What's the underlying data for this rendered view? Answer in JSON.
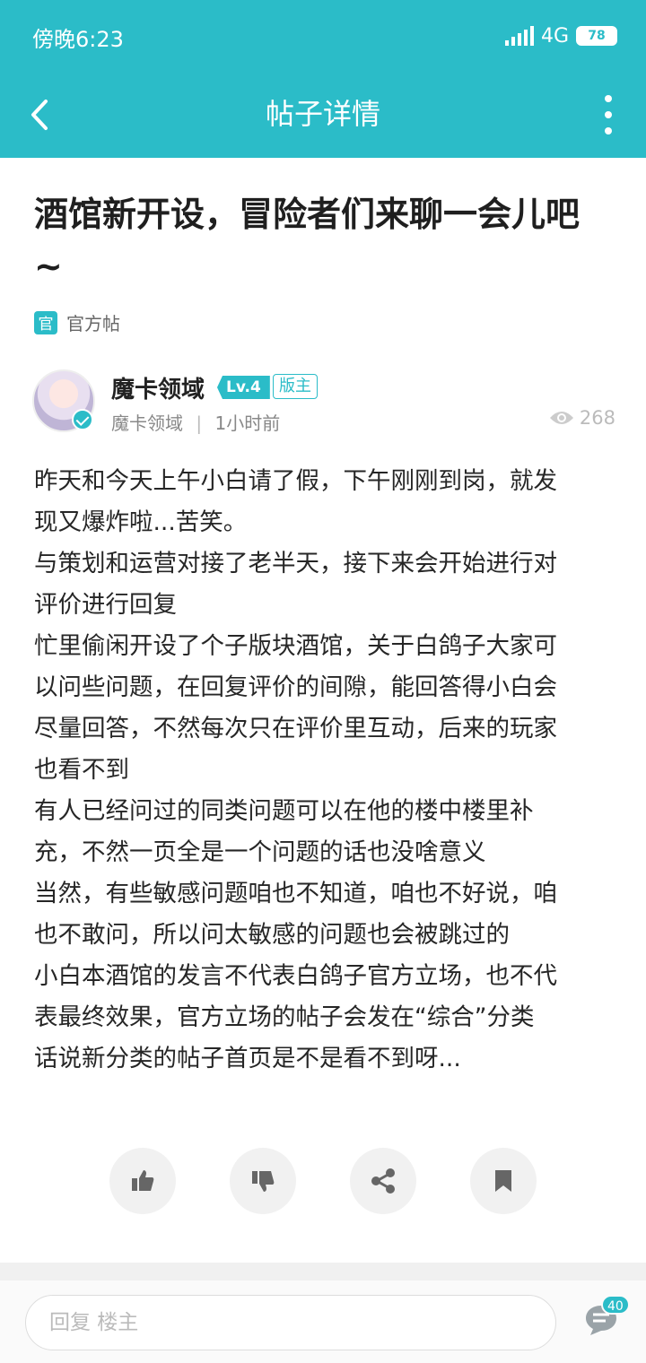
{
  "status_bar": {
    "time": "傍晚6:23",
    "network": "4G",
    "battery": "78"
  },
  "nav": {
    "title": "帖子详情"
  },
  "post": {
    "title_line1": "酒馆新开设，冒险者们来聊一会儿吧",
    "title_line2": "~",
    "official_badge": "官",
    "official_label": "官方帖",
    "author": {
      "name": "魔卡领域",
      "level": "Lv.4",
      "role": "版主",
      "section": "魔卡领域",
      "separator": "|",
      "time": "1小时前",
      "views": "268"
    },
    "body_lines": [
      "昨天和今天上午小白请了假，下午刚刚到岗，就发",
      "现又爆炸啦...苦笑。",
      "与策划和运营对接了老半天，接下来会开始进行对",
      "评价进行回复",
      "忙里偷闲开设了个子版块酒馆，关于白鸽子大家可",
      "以问些问题，在回复评价的间隙，能回答得小白会",
      "尽量回答，不然每次只在评价里互动，后来的玩家",
      "也看不到",
      "有人已经问过的同类问题可以在他的楼中楼里补",
      "充，不然一页全是一个问题的话也没啥意义",
      "当然，有些敏感问题咱也不知道，咱也不好说，咱",
      "也不敢问，所以问太敏感的问题也会被跳过的",
      "小白本酒馆的发言不代表白鸽子官方立场，也不代",
      "表最终效果，官方立场的帖子会发在“综合”分类",
      "话说新分类的帖子首页是不是看不到呀..."
    ]
  },
  "bottom": {
    "reply_placeholder": "回复  楼主",
    "comment_count": "40"
  },
  "colors": {
    "accent": "#2bbcc8"
  },
  "icons": [
    "back-icon",
    "more-icon",
    "eye-icon",
    "thumbs-up-icon",
    "thumbs-down-icon",
    "share-icon",
    "bookmark-icon",
    "comment-icon"
  ]
}
